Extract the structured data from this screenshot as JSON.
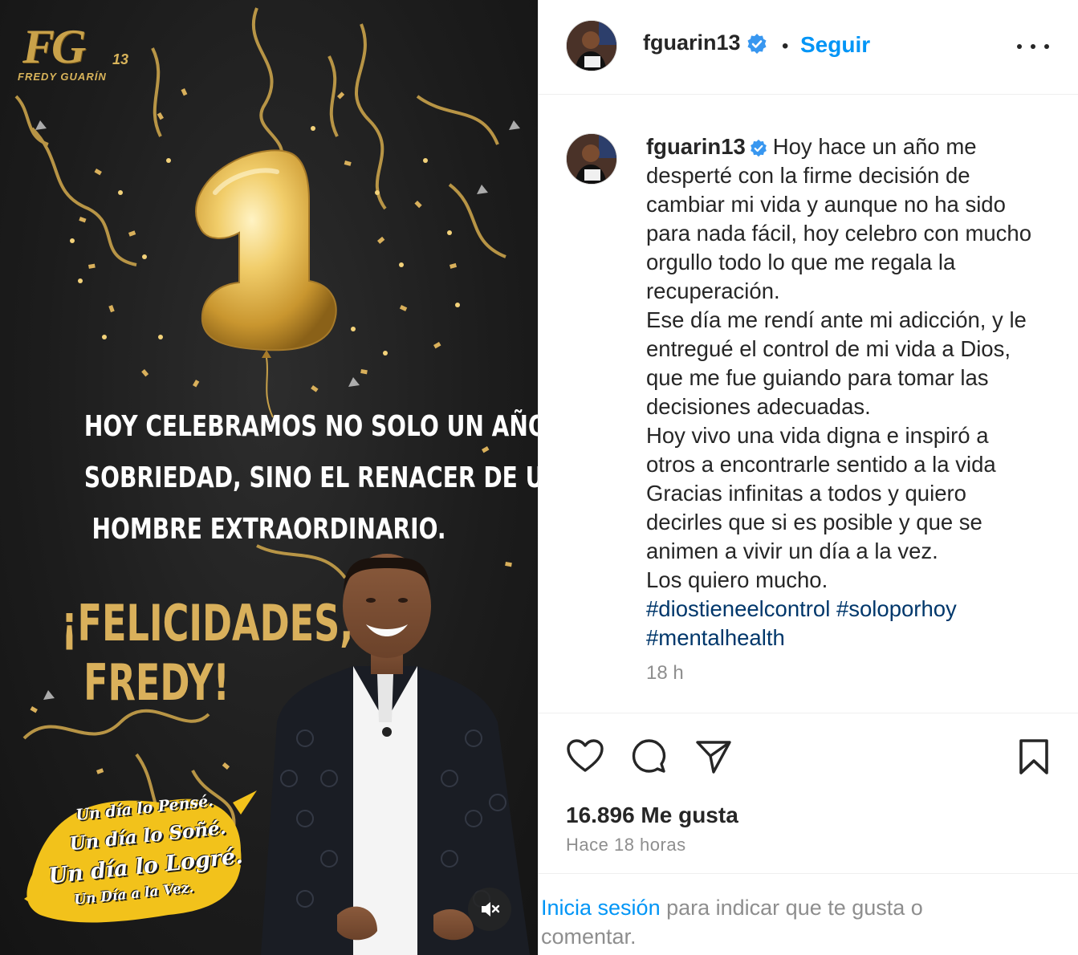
{
  "media": {
    "logo_mark": "FG",
    "logo_number": "13",
    "logo_name": "FREDY GUARÍN",
    "balloon_number": "1",
    "headline_lines": [
      "HOY CELEBRAMOS NO SOLO UN AÑO DE",
      "SOBRIEDAD, SINO EL RENACER DE UN",
      "HOMBRE EXTRAORDINARIO."
    ],
    "congrats_lines": [
      "¡FELICIDADES,",
      "FREDY!"
    ],
    "slogan_lines": [
      "Un día lo Pensé.",
      "Un día lo Soñé.",
      "Un día lo Logré.",
      "Un Día a la Vez."
    ],
    "mute_icon": "speaker-muted-icon",
    "colors": {
      "gold": "#d9b05b",
      "background": "#1c1c1c",
      "splash": "#f2c21b"
    }
  },
  "header": {
    "username": "fguarin13",
    "separator": "•",
    "follow_label": "Seguir",
    "verified_icon": "verified-badge-icon",
    "more_icon": "more-options-icon"
  },
  "caption": {
    "username": "fguarin13",
    "first_line": "Hoy hace un año me",
    "lines": [
      "desperté con la firme decisión de",
      "cambiar mi vida y aunque no ha sido",
      "para nada fácil, hoy celebro con mucho",
      "orgullo todo lo que me regala la",
      "recuperación.",
      "Ese día me rendí ante mi adicción, y le",
      "entregué el control de mi vida a Dios,",
      "que me fue guiando para tomar las",
      "decisiones adecuadas.",
      "Hoy vivo una vida digna e inspiró a",
      "otros a encontrarle sentido a la vida",
      "Gracias infinitas a todos y quiero",
      "decirles que si es posible y que se",
      "animen a vivir un día a la vez.",
      "Los quiero mucho."
    ],
    "hashtags": [
      "#diostieneelcontrol",
      "#soloporhoy",
      "#mentalhealth"
    ],
    "time": "18 h"
  },
  "actions": {
    "like_icon": "heart-icon",
    "comment_icon": "comment-icon",
    "share_icon": "send-icon",
    "save_icon": "bookmark-icon"
  },
  "stats": {
    "likes": "16.896 Me gusta",
    "posted": "Hace 18 horas"
  },
  "login": {
    "link": "Inicia sesión",
    "rest": " para indicar que te gusta o comentar."
  },
  "colors": {
    "link_blue": "#0095f6",
    "hashtag": "#00376b",
    "muted": "#8e8e8e",
    "text": "#262626"
  }
}
